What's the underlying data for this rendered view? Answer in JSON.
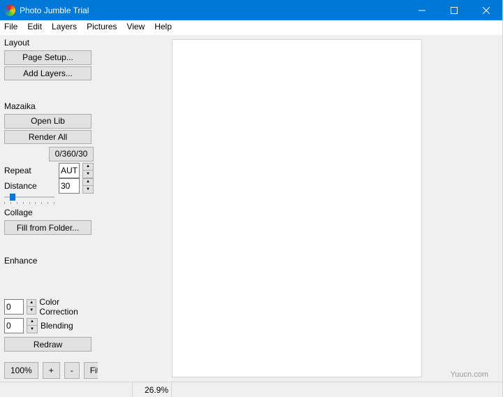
{
  "window": {
    "title": "Photo Jumble Trial"
  },
  "menubar": {
    "file": "File",
    "edit": "Edit",
    "layers": "Layers",
    "pictures": "Pictures",
    "view": "View",
    "help": "Help"
  },
  "layout": {
    "label": "Layout",
    "page_setup": "Page Setup...",
    "add_layers": "Add Layers..."
  },
  "mazaika": {
    "label": "Mazaika",
    "open_lib": "Open Lib",
    "render_all": "Render All",
    "progress": "0/360/30",
    "repeat_label": "Repeat",
    "repeat_value": "AUTO",
    "distance_label": "Distance",
    "distance_value": "30"
  },
  "collage": {
    "label": "Collage",
    "fill_from_folder": "Fill from Folder..."
  },
  "enhance": {
    "label": "Enhance",
    "color_correction_label": "Color Correction",
    "color_correction_value": "0",
    "blending_label": "Blending",
    "blending_value": "0",
    "redraw": "Redraw"
  },
  "zoom": {
    "zoom_level": "100%",
    "plus": "+",
    "minus": "-",
    "fit": "Fit"
  },
  "statusbar": {
    "percent": "26.9%"
  },
  "watermark": "Yuucn.com"
}
